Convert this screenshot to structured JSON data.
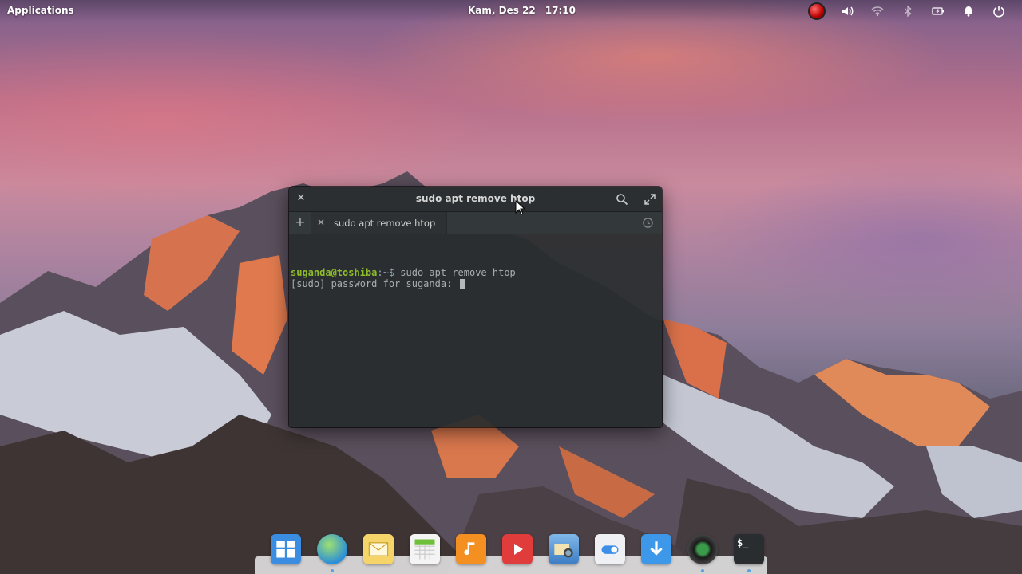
{
  "panel": {
    "applications_label": "Applications",
    "date": "Kam, Des 22",
    "time": "17:10",
    "indicators": [
      "record-icon",
      "volume-icon",
      "wifi-icon",
      "bluetooth-icon",
      "battery-icon",
      "notifications-icon",
      "power-icon"
    ]
  },
  "terminal": {
    "title": "sudo apt remove htop",
    "tab_label": "sudo apt remove htop",
    "prompt_user": "suganda@toshiba",
    "prompt_path": ":~$",
    "command": " sudo apt remove htop",
    "output_line": "[sudo] password for suganda: "
  },
  "dock": {
    "items": [
      "multitasking-view",
      "web-browser",
      "mail",
      "calendar",
      "music",
      "videos",
      "photos",
      "system-settings",
      "appcenter",
      "camera",
      "terminal"
    ]
  },
  "colors": {
    "prompt_user": "#8ebd2a",
    "terminal_bg": "#282c2d",
    "dock_bg": "#ebebeb"
  }
}
